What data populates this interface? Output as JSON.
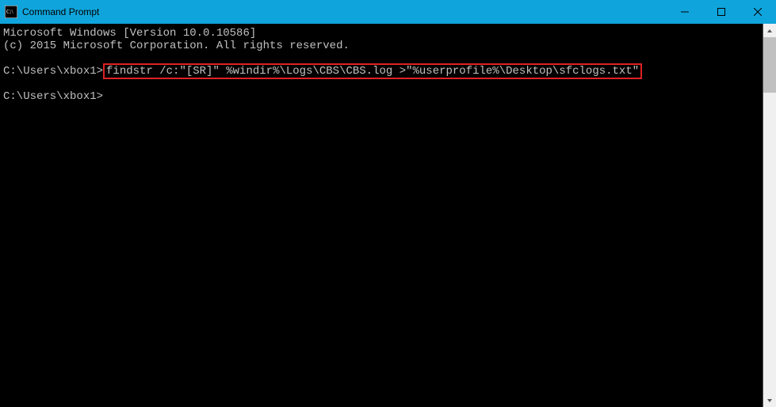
{
  "titlebar": {
    "title": "Command Prompt",
    "icon_alt": "cmd-app-icon"
  },
  "window_controls": {
    "minimize": "minimize",
    "maximize": "maximize",
    "close": "close"
  },
  "terminal": {
    "line1": "Microsoft Windows [Version 10.0.10586]",
    "line2": "(c) 2015 Microsoft Corporation. All rights reserved.",
    "blank1": "",
    "prompt1_prefix": "C:\\Users\\xbox1>",
    "prompt1_command": "findstr /c:\"[SR]\" %windir%\\Logs\\CBS\\CBS.log >\"%userprofile%\\Desktop\\sfclogs.txt\"",
    "blank2": "",
    "prompt2": "C:\\Users\\xbox1>"
  }
}
